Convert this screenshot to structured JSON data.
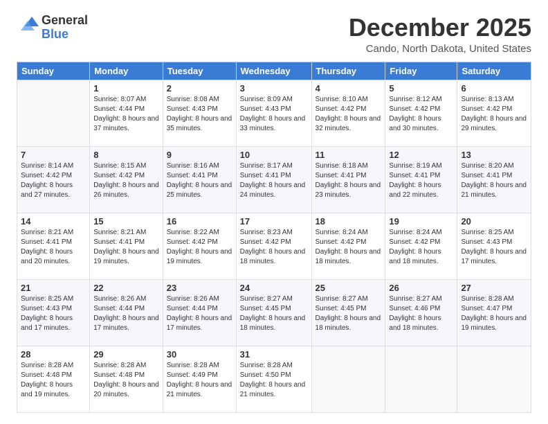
{
  "logo": {
    "general": "General",
    "blue": "Blue"
  },
  "header": {
    "month": "December 2025",
    "location": "Cando, North Dakota, United States"
  },
  "weekdays": [
    "Sunday",
    "Monday",
    "Tuesday",
    "Wednesday",
    "Thursday",
    "Friday",
    "Saturday"
  ],
  "weeks": [
    [
      {
        "day": "",
        "sunrise": "",
        "sunset": "",
        "daylight": ""
      },
      {
        "day": "1",
        "sunrise": "Sunrise: 8:07 AM",
        "sunset": "Sunset: 4:44 PM",
        "daylight": "Daylight: 8 hours and 37 minutes."
      },
      {
        "day": "2",
        "sunrise": "Sunrise: 8:08 AM",
        "sunset": "Sunset: 4:43 PM",
        "daylight": "Daylight: 8 hours and 35 minutes."
      },
      {
        "day": "3",
        "sunrise": "Sunrise: 8:09 AM",
        "sunset": "Sunset: 4:43 PM",
        "daylight": "Daylight: 8 hours and 33 minutes."
      },
      {
        "day": "4",
        "sunrise": "Sunrise: 8:10 AM",
        "sunset": "Sunset: 4:42 PM",
        "daylight": "Daylight: 8 hours and 32 minutes."
      },
      {
        "day": "5",
        "sunrise": "Sunrise: 8:12 AM",
        "sunset": "Sunset: 4:42 PM",
        "daylight": "Daylight: 8 hours and 30 minutes."
      },
      {
        "day": "6",
        "sunrise": "Sunrise: 8:13 AM",
        "sunset": "Sunset: 4:42 PM",
        "daylight": "Daylight: 8 hours and 29 minutes."
      }
    ],
    [
      {
        "day": "7",
        "sunrise": "Sunrise: 8:14 AM",
        "sunset": "Sunset: 4:42 PM",
        "daylight": "Daylight: 8 hours and 27 minutes."
      },
      {
        "day": "8",
        "sunrise": "Sunrise: 8:15 AM",
        "sunset": "Sunset: 4:42 PM",
        "daylight": "Daylight: 8 hours and 26 minutes."
      },
      {
        "day": "9",
        "sunrise": "Sunrise: 8:16 AM",
        "sunset": "Sunset: 4:41 PM",
        "daylight": "Daylight: 8 hours and 25 minutes."
      },
      {
        "day": "10",
        "sunrise": "Sunrise: 8:17 AM",
        "sunset": "Sunset: 4:41 PM",
        "daylight": "Daylight: 8 hours and 24 minutes."
      },
      {
        "day": "11",
        "sunrise": "Sunrise: 8:18 AM",
        "sunset": "Sunset: 4:41 PM",
        "daylight": "Daylight: 8 hours and 23 minutes."
      },
      {
        "day": "12",
        "sunrise": "Sunrise: 8:19 AM",
        "sunset": "Sunset: 4:41 PM",
        "daylight": "Daylight: 8 hours and 22 minutes."
      },
      {
        "day": "13",
        "sunrise": "Sunrise: 8:20 AM",
        "sunset": "Sunset: 4:41 PM",
        "daylight": "Daylight: 8 hours and 21 minutes."
      }
    ],
    [
      {
        "day": "14",
        "sunrise": "Sunrise: 8:21 AM",
        "sunset": "Sunset: 4:41 PM",
        "daylight": "Daylight: 8 hours and 20 minutes."
      },
      {
        "day": "15",
        "sunrise": "Sunrise: 8:21 AM",
        "sunset": "Sunset: 4:41 PM",
        "daylight": "Daylight: 8 hours and 19 minutes."
      },
      {
        "day": "16",
        "sunrise": "Sunrise: 8:22 AM",
        "sunset": "Sunset: 4:42 PM",
        "daylight": "Daylight: 8 hours and 19 minutes."
      },
      {
        "day": "17",
        "sunrise": "Sunrise: 8:23 AM",
        "sunset": "Sunset: 4:42 PM",
        "daylight": "Daylight: 8 hours and 18 minutes."
      },
      {
        "day": "18",
        "sunrise": "Sunrise: 8:24 AM",
        "sunset": "Sunset: 4:42 PM",
        "daylight": "Daylight: 8 hours and 18 minutes."
      },
      {
        "day": "19",
        "sunrise": "Sunrise: 8:24 AM",
        "sunset": "Sunset: 4:42 PM",
        "daylight": "Daylight: 8 hours and 18 minutes."
      },
      {
        "day": "20",
        "sunrise": "Sunrise: 8:25 AM",
        "sunset": "Sunset: 4:43 PM",
        "daylight": "Daylight: 8 hours and 17 minutes."
      }
    ],
    [
      {
        "day": "21",
        "sunrise": "Sunrise: 8:25 AM",
        "sunset": "Sunset: 4:43 PM",
        "daylight": "Daylight: 8 hours and 17 minutes."
      },
      {
        "day": "22",
        "sunrise": "Sunrise: 8:26 AM",
        "sunset": "Sunset: 4:44 PM",
        "daylight": "Daylight: 8 hours and 17 minutes."
      },
      {
        "day": "23",
        "sunrise": "Sunrise: 8:26 AM",
        "sunset": "Sunset: 4:44 PM",
        "daylight": "Daylight: 8 hours and 17 minutes."
      },
      {
        "day": "24",
        "sunrise": "Sunrise: 8:27 AM",
        "sunset": "Sunset: 4:45 PM",
        "daylight": "Daylight: 8 hours and 18 minutes."
      },
      {
        "day": "25",
        "sunrise": "Sunrise: 8:27 AM",
        "sunset": "Sunset: 4:45 PM",
        "daylight": "Daylight: 8 hours and 18 minutes."
      },
      {
        "day": "26",
        "sunrise": "Sunrise: 8:27 AM",
        "sunset": "Sunset: 4:46 PM",
        "daylight": "Daylight: 8 hours and 18 minutes."
      },
      {
        "day": "27",
        "sunrise": "Sunrise: 8:28 AM",
        "sunset": "Sunset: 4:47 PM",
        "daylight": "Daylight: 8 hours and 19 minutes."
      }
    ],
    [
      {
        "day": "28",
        "sunrise": "Sunrise: 8:28 AM",
        "sunset": "Sunset: 4:48 PM",
        "daylight": "Daylight: 8 hours and 19 minutes."
      },
      {
        "day": "29",
        "sunrise": "Sunrise: 8:28 AM",
        "sunset": "Sunset: 4:48 PM",
        "daylight": "Daylight: 8 hours and 20 minutes."
      },
      {
        "day": "30",
        "sunrise": "Sunrise: 8:28 AM",
        "sunset": "Sunset: 4:49 PM",
        "daylight": "Daylight: 8 hours and 21 minutes."
      },
      {
        "day": "31",
        "sunrise": "Sunrise: 8:28 AM",
        "sunset": "Sunset: 4:50 PM",
        "daylight": "Daylight: 8 hours and 21 minutes."
      },
      {
        "day": "",
        "sunrise": "",
        "sunset": "",
        "daylight": ""
      },
      {
        "day": "",
        "sunrise": "",
        "sunset": "",
        "daylight": ""
      },
      {
        "day": "",
        "sunrise": "",
        "sunset": "",
        "daylight": ""
      }
    ]
  ]
}
